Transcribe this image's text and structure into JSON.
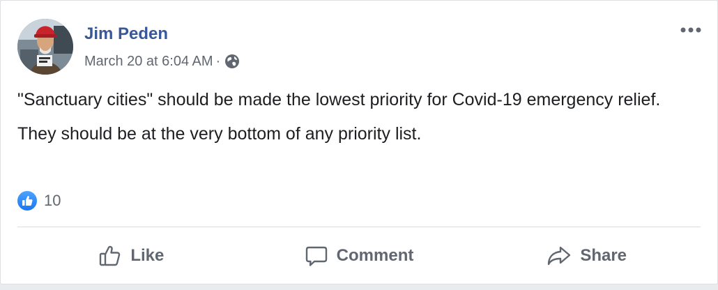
{
  "post": {
    "author_name": "Jim Peden",
    "timestamp": "March 20 at 6:04 AM",
    "separator": "·",
    "privacy_icon": "globe-icon",
    "more_icon": "more-options-icon",
    "paragraphs": [
      "\"Sanctuary cities\" should be made the lowest priority for Covid-19 emergency relief.",
      "They should be at the very bottom of any priority list."
    ],
    "reactions": {
      "icon": "like-reaction-icon",
      "count": "10"
    }
  },
  "actions": {
    "like_label": "Like",
    "comment_label": "Comment",
    "share_label": "Share"
  },
  "colors": {
    "author_link": "#385898",
    "secondary_text": "#616770",
    "like_blue": "#1877f2"
  }
}
